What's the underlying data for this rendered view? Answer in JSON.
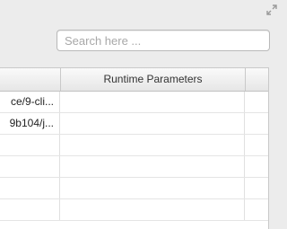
{
  "search": {
    "placeholder": "Search here ...",
    "value": ""
  },
  "table": {
    "columns": [
      "",
      "Runtime Parameters",
      ""
    ],
    "rows": [
      [
        "ce/9-cli...",
        "",
        ""
      ],
      [
        "9b104/j...",
        "",
        ""
      ],
      [
        "",
        "",
        ""
      ],
      [
        "",
        "",
        ""
      ],
      [
        "",
        "",
        ""
      ],
      [
        "",
        "",
        ""
      ]
    ]
  },
  "icons": {
    "resize": "expand-arrows-icon"
  }
}
